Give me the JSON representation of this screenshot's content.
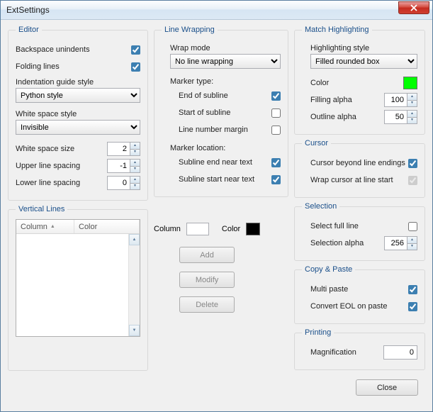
{
  "window": {
    "title": "ExtSettings",
    "close_button": "Close"
  },
  "editor": {
    "legend": "Editor",
    "backspace_unindents": "Backspace unindents",
    "folding_lines": "Folding lines",
    "indent_guide_label": "Indentation guide style",
    "indent_guide_value": "Python style",
    "whitespace_style_label": "White space style",
    "whitespace_style_value": "Invisible",
    "whitespace_size_label": "White space size",
    "whitespace_size_value": "2",
    "upper_spacing_label": "Upper line spacing",
    "upper_spacing_value": "-1",
    "lower_spacing_label": "Lower line spacing",
    "lower_spacing_value": "0"
  },
  "vlines": {
    "legend": "Vertical Lines",
    "col_column": "Column",
    "col_color": "Color",
    "column_label": "Column",
    "color_label": "Color",
    "add": "Add",
    "modify": "Modify",
    "delete": "Delete"
  },
  "wrap": {
    "legend": "Line Wrapping",
    "mode_label": "Wrap mode",
    "mode_value": "No line wrapping",
    "marker_type_label": "Marker type:",
    "end_subline": "End of subline",
    "start_subline": "Start of subline",
    "line_margin": "Line number margin",
    "marker_loc_label": "Marker location:",
    "end_near": "Subline end near text",
    "start_near": "Subline start near text"
  },
  "match": {
    "legend": "Match Highlighting",
    "style_label": "Highlighting style",
    "style_value": "Filled rounded box",
    "color_label": "Color",
    "color_value": "#00ff00",
    "fill_alpha_label": "Filling alpha",
    "fill_alpha_value": "100",
    "outline_alpha_label": "Outline alpha",
    "outline_alpha_value": "50"
  },
  "cursor": {
    "legend": "Cursor",
    "beyond": "Cursor beyond line endings",
    "wrap_start": "Wrap cursor at line start"
  },
  "selection": {
    "legend": "Selection",
    "full_line": "Select full line",
    "alpha_label": "Selection alpha",
    "alpha_value": "256"
  },
  "copy": {
    "legend": "Copy & Paste",
    "multi": "Multi paste",
    "convert_eol": "Convert EOL on paste"
  },
  "print": {
    "legend": "Printing",
    "mag_label": "Magnification",
    "mag_value": "0"
  }
}
